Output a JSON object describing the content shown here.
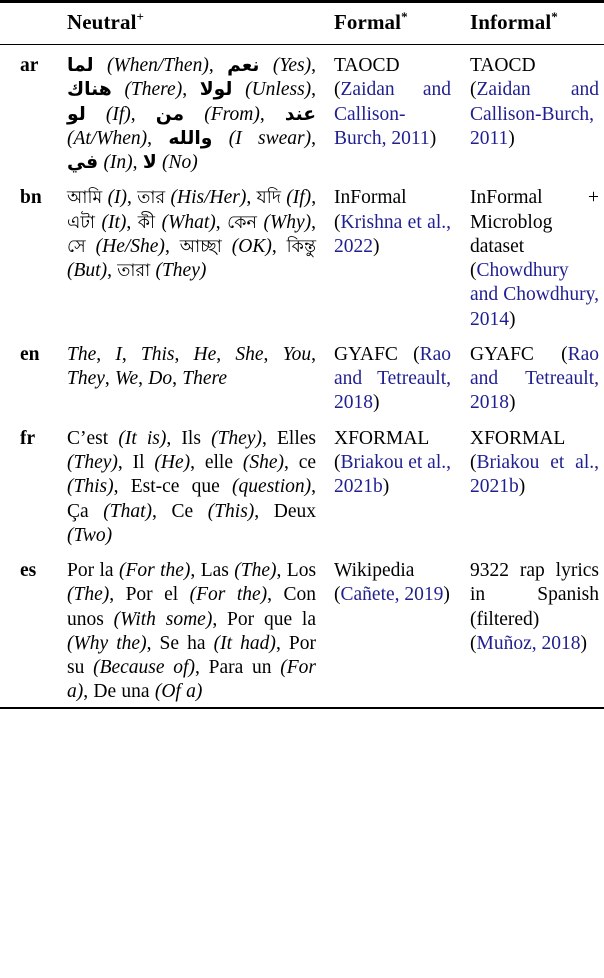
{
  "table": {
    "columns": [
      {
        "key": "lang",
        "label": ""
      },
      {
        "key": "neutral",
        "label": "Neutral",
        "sup": "+"
      },
      {
        "key": "formal",
        "label": "Formal",
        "sup": "*"
      },
      {
        "key": "informal",
        "label": "Informal",
        "sup": "*"
      }
    ],
    "citation_color": "#201f8f",
    "rows": [
      {
        "lang": "ar",
        "neutral_plain": "لما (When/Then), نعم (Yes), هناك (There), لولا (Unless), لو (If), من (From), عند (At/When), والله (I swear), في (In), لا (No)",
        "neutral_items": [
          {
            "word": "لما",
            "script": "arabic",
            "gloss": "When/Then"
          },
          {
            "word": "نعم",
            "script": "arabic",
            "gloss": "Yes"
          },
          {
            "word": "هناك",
            "script": "arabic",
            "gloss": "There"
          },
          {
            "word": "لولا",
            "script": "arabic",
            "gloss": "Unless"
          },
          {
            "word": "لو",
            "script": "arabic",
            "gloss": "If"
          },
          {
            "word": "من",
            "script": "arabic",
            "gloss": "From"
          },
          {
            "word": "عند",
            "script": "arabic",
            "gloss": "At/When"
          },
          {
            "word": "والله",
            "script": "arabic",
            "gloss": "I swear"
          },
          {
            "word": "في",
            "script": "arabic",
            "gloss": "In"
          },
          {
            "word": "لا",
            "script": "arabic",
            "gloss": "No"
          }
        ],
        "formal": {
          "dataset": "TAOCD",
          "citation": "(Zaidan and Callison-Burch, 2011)"
        },
        "informal": {
          "dataset": "TAOCD",
          "citation": "(Zaidan and Callison-Burch, 2011)"
        }
      },
      {
        "lang": "bn",
        "neutral_plain": "আমি (I), তার (His/Her), যদি (If), এটা (It), কী (What), কেন (Why), সে (He/She), আচ্ছা (OK), কিন্তু (But), তারা (They)",
        "neutral_items": [
          {
            "word": "আমি",
            "script": "bengali",
            "gloss": "I"
          },
          {
            "word": "তার",
            "script": "bengali",
            "gloss": "His/Her"
          },
          {
            "word": "যদি",
            "script": "bengali",
            "gloss": "If"
          },
          {
            "word": "এটা",
            "script": "bengali",
            "gloss": "It"
          },
          {
            "word": "কী",
            "script": "bengali",
            "gloss": "What"
          },
          {
            "word": "কেন",
            "script": "bengali",
            "gloss": "Why"
          },
          {
            "word": "সে",
            "script": "bengali",
            "gloss": "He/She"
          },
          {
            "word": "আচ্ছা",
            "script": "bengali",
            "gloss": "OK"
          },
          {
            "word": "কিন্তু",
            "script": "bengali",
            "gloss": "But"
          },
          {
            "word": "তারা",
            "script": "bengali",
            "gloss": "They"
          }
        ],
        "formal": {
          "dataset": "InFormal",
          "citation": "(Krishna et al., 2022)"
        },
        "informal": {
          "dataset": "InFormal + Microblog dataset",
          "citation": "(Chowdhury and Chowdhury, 2014)"
        }
      },
      {
        "lang": "en",
        "neutral_plain": "The, I, This, He, She, You, They, We, Do, There",
        "neutral_items": [
          {
            "word": "The",
            "script": "latin",
            "gloss": ""
          },
          {
            "word": "I",
            "script": "latin",
            "gloss": ""
          },
          {
            "word": "This",
            "script": "latin",
            "gloss": ""
          },
          {
            "word": "He",
            "script": "latin",
            "gloss": ""
          },
          {
            "word": "She",
            "script": "latin",
            "gloss": ""
          },
          {
            "word": "You",
            "script": "latin",
            "gloss": ""
          },
          {
            "word": "They",
            "script": "latin",
            "gloss": ""
          },
          {
            "word": "We",
            "script": "latin",
            "gloss": ""
          },
          {
            "word": "Do",
            "script": "latin",
            "gloss": ""
          },
          {
            "word": "There",
            "script": "latin",
            "gloss": ""
          }
        ],
        "formal": {
          "dataset": "GYAFC",
          "citation": "(Rao and Tetreault, 2018)"
        },
        "informal": {
          "dataset": "GYAFC",
          "citation": "(Rao and Tetreault, 2018)"
        }
      },
      {
        "lang": "fr",
        "neutral_plain": "C’est (It is), Ils (They), Elles (They), Il (He), elle (She), ce (This), Est-ce que (question), Ça (That), Ce (This), Deux (Two)",
        "neutral_items": [
          {
            "word": "C’est",
            "script": "latin",
            "gloss": "It is"
          },
          {
            "word": "Ils",
            "script": "latin",
            "gloss": "They"
          },
          {
            "word": "Elles",
            "script": "latin",
            "gloss": "They"
          },
          {
            "word": "Il",
            "script": "latin",
            "gloss": "He"
          },
          {
            "word": "elle",
            "script": "latin",
            "gloss": "She"
          },
          {
            "word": "ce",
            "script": "latin",
            "gloss": "This"
          },
          {
            "word": "Est-ce que",
            "script": "latin",
            "gloss": "question"
          },
          {
            "word": "Ça",
            "script": "latin",
            "gloss": "That"
          },
          {
            "word": "Ce",
            "script": "latin",
            "gloss": "This"
          },
          {
            "word": "Deux",
            "script": "latin",
            "gloss": "Two"
          }
        ],
        "formal": {
          "dataset": "XFORMAL",
          "citation": "(Briakou et al., 2021b)"
        },
        "informal": {
          "dataset": "XFORMAL",
          "citation": "(Briakou et al., 2021b)"
        }
      },
      {
        "lang": "es",
        "neutral_plain": "Por la (For the), Las (The), Los (The), Por el (For the), Con unos (With some), Por que la (Why the), Se ha (It had), Por su (Because of), Para un (For a), De una (Of a)",
        "neutral_items": [
          {
            "word": "Por la",
            "script": "latin",
            "gloss": "For the"
          },
          {
            "word": "Las",
            "script": "latin",
            "gloss": "The"
          },
          {
            "word": "Los",
            "script": "latin",
            "gloss": "The"
          },
          {
            "word": "Por el",
            "script": "latin",
            "gloss": "For the"
          },
          {
            "word": "Con unos",
            "script": "latin",
            "gloss": "With some"
          },
          {
            "word": "Por que la",
            "script": "latin",
            "gloss": "Why the"
          },
          {
            "word": "Se ha",
            "script": "latin",
            "gloss": "It had"
          },
          {
            "word": "Por su",
            "script": "latin",
            "gloss": "Because of"
          },
          {
            "word": "Para un",
            "script": "latin",
            "gloss": "For a"
          },
          {
            "word": "De una",
            "script": "latin",
            "gloss": "Of a"
          }
        ],
        "formal": {
          "dataset": "Wikipedia",
          "citation": "(Cañete, 2019)"
        },
        "informal": {
          "dataset": "9322 rap lyrics in Spanish (filtered)",
          "citation": "(Muñoz, 2018)"
        }
      }
    ]
  }
}
